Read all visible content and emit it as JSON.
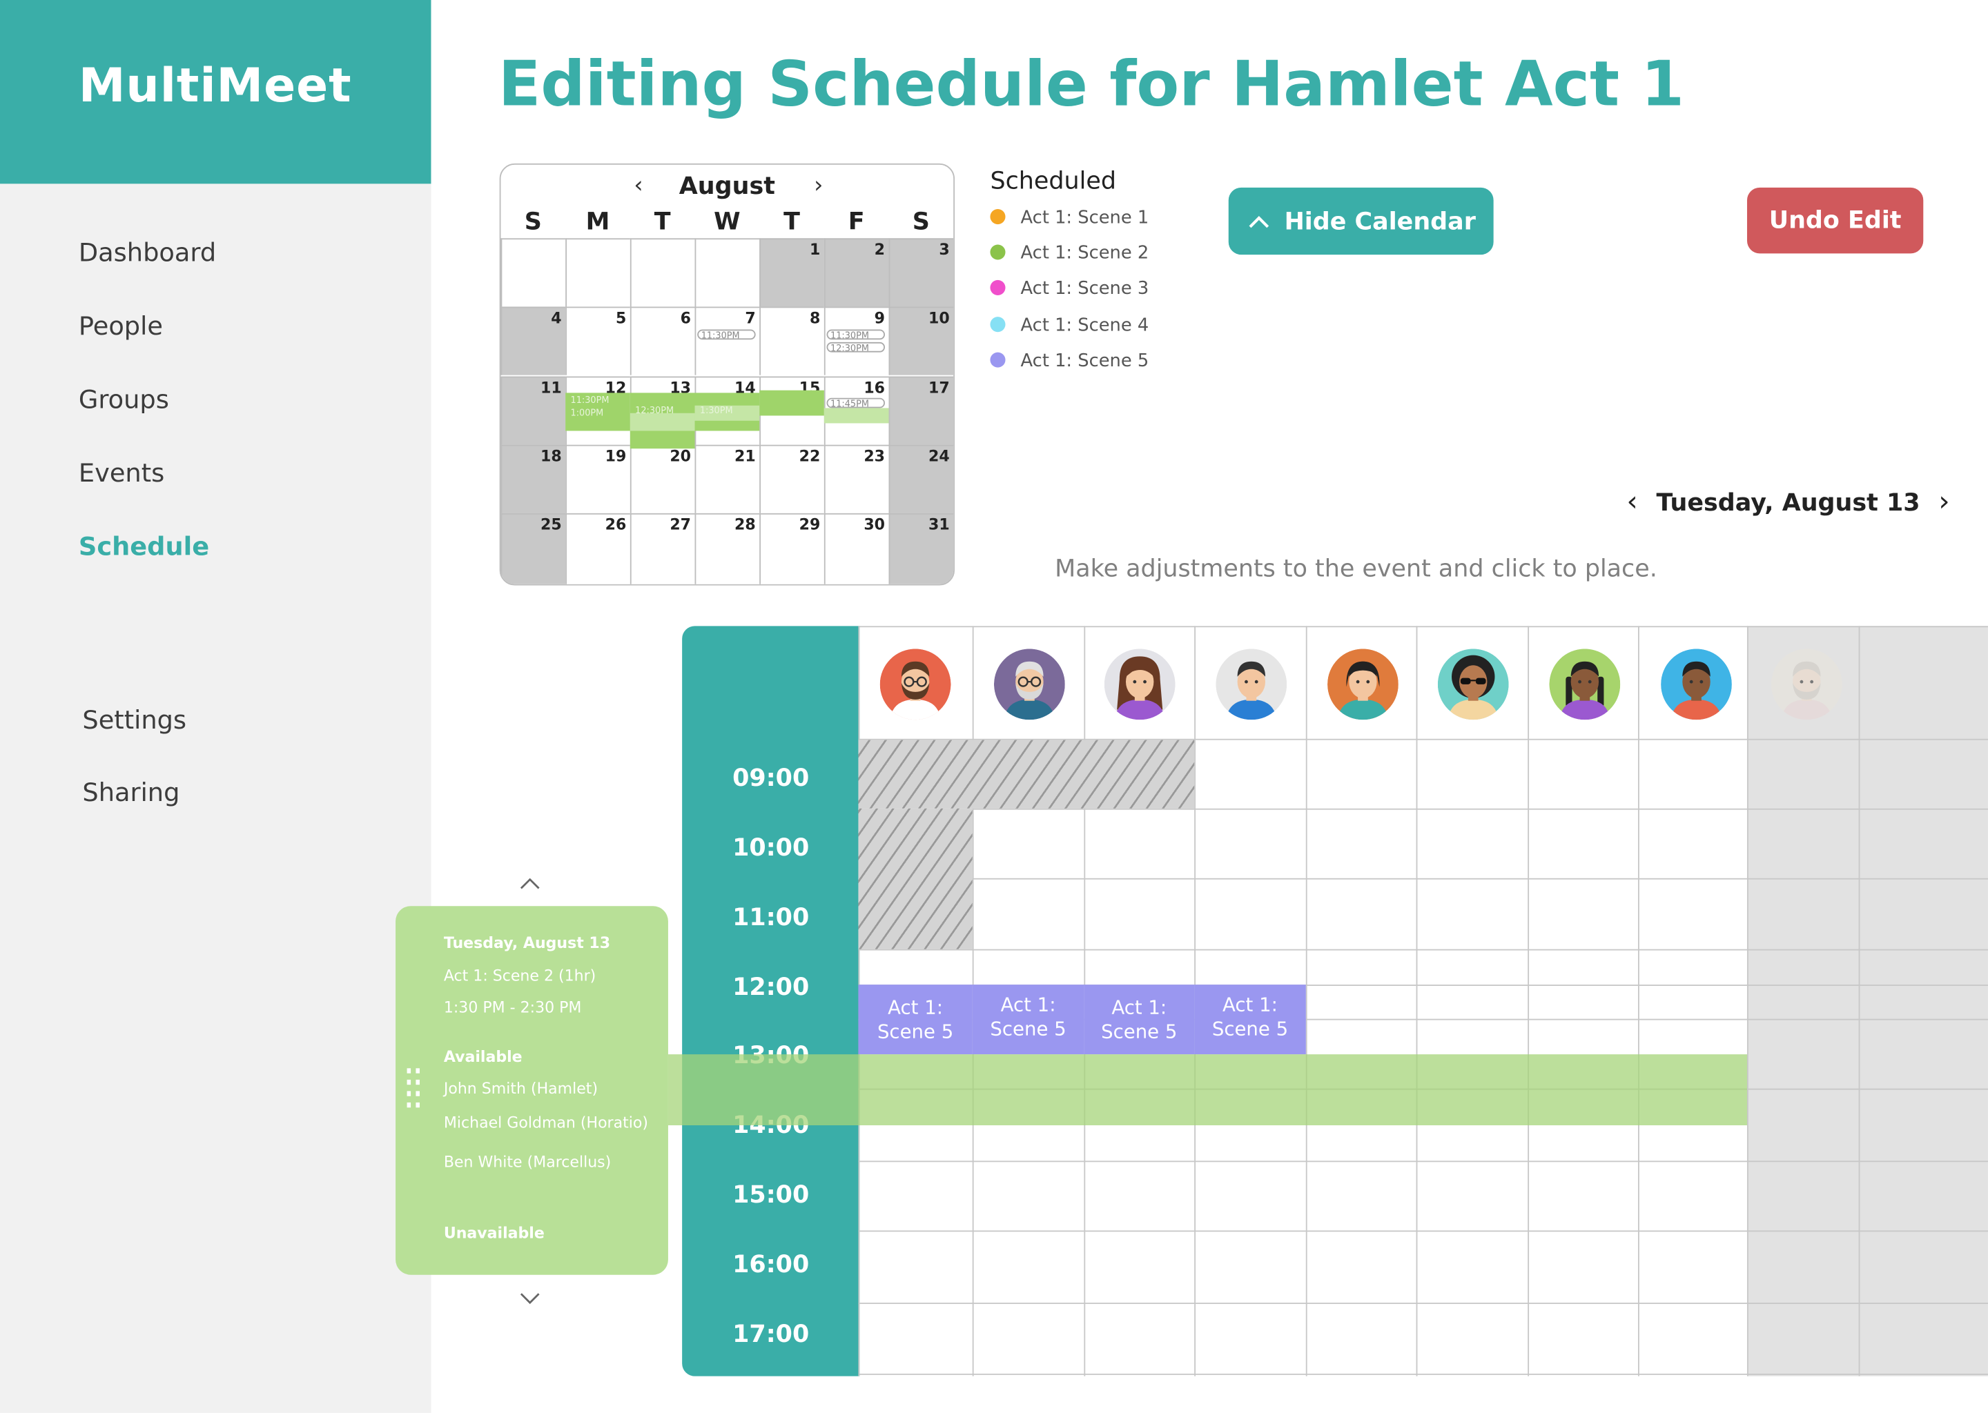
{
  "brand": "MultiMeet",
  "nav": {
    "dashboard": "Dashboard",
    "people": "People",
    "groups": "Groups",
    "events": "Events",
    "schedule": "Schedule",
    "settings": "Settings",
    "sharing": "Sharing"
  },
  "page_title": "Editing Schedule for Hamlet Act 1",
  "calendar": {
    "month": "August",
    "prev": "‹",
    "next": "›",
    "weekdays": [
      "S",
      "M",
      "T",
      "W",
      "T",
      "F",
      "S"
    ],
    "days": [
      "",
      "",
      "",
      "",
      "1",
      "2",
      "3",
      "4",
      "5",
      "6",
      "7",
      "8",
      "9",
      "10",
      "11",
      "12",
      "13",
      "14",
      "15",
      "16",
      "17",
      "18",
      "19",
      "20",
      "21",
      "22",
      "23",
      "24",
      "25",
      "26",
      "27",
      "28",
      "29",
      "30",
      "31"
    ],
    "events": {
      "aug7": "11:30PM",
      "aug9a": "11:30PM",
      "aug9b": "12:30PM",
      "aug12a": "11:30PM",
      "aug12b": "1:00PM",
      "aug13": "12:30PM",
      "aug14": "1:30PM",
      "aug16": "11:45PM"
    }
  },
  "legend": {
    "heading": "Scheduled",
    "items": [
      {
        "label": "Act 1: Scene 1",
        "color": "#f5a623"
      },
      {
        "label": "Act 1: Scene 2",
        "color": "#8bc34a"
      },
      {
        "label": "Act 1: Scene 3",
        "color": "#f04fcb"
      },
      {
        "label": "Act 1: Scene 4",
        "color": "#86e0f4"
      },
      {
        "label": "Act 1: Scene 5",
        "color": "#9a97f0"
      }
    ]
  },
  "buttons": {
    "hide_calendar": "Hide Calendar",
    "undo_edit": "Undo Edit"
  },
  "date_nav": {
    "label": "Tuesday, August 13",
    "prev": "‹",
    "next": "›"
  },
  "hint": "Make adjustments to the event and click to place.",
  "times": [
    "09:00",
    "10:00",
    "11:00",
    "12:00",
    "13:00",
    "14:00",
    "15:00",
    "16:00",
    "17:00"
  ],
  "scene5_label": "Act 1: Scene 5",
  "popup": {
    "date": "Tuesday, August 13",
    "event": "Act 1: Scene 2 (1hr)",
    "time": "1:30 PM - 2:30 PM",
    "available_heading": "Available",
    "available": [
      "John Smith (Hamlet)",
      "Michael Goldman (Horatio)",
      "Ben White (Marcellus)"
    ],
    "unavailable_heading": "Unavailable"
  },
  "colors": {
    "accent": "#3aaea8",
    "undo": "#d0595c",
    "scene2_band": "#a6d47a",
    "scene5": "#9a97f0"
  }
}
